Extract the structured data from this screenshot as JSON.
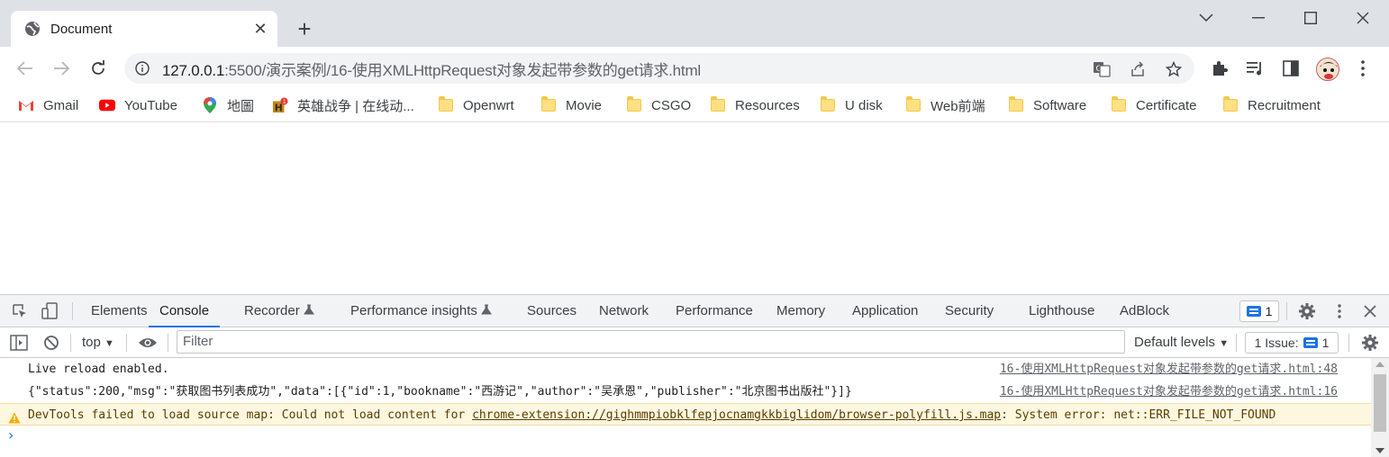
{
  "browser": {
    "tab": {
      "title": "Document"
    },
    "omnibox": {
      "host": "127.0.0.1",
      "path": ":5500/演示案例/16-使用XMLHttpRequest对象发起带参数的get请求.html"
    },
    "bookmarks": [
      {
        "label": "Gmail",
        "icon": "gmail-icon"
      },
      {
        "label": "YouTube",
        "icon": "youtube-icon"
      },
      {
        "label": "地圖",
        "icon": "maps-icon"
      },
      {
        "label": "英雄战争 | 在线动...",
        "icon": "game-icon"
      },
      {
        "label": "Openwrt",
        "icon": "folder-icon"
      },
      {
        "label": "Movie",
        "icon": "folder-icon"
      },
      {
        "label": "CSGO",
        "icon": "folder-icon"
      },
      {
        "label": "Resources",
        "icon": "folder-icon"
      },
      {
        "label": "U disk",
        "icon": "folder-icon"
      },
      {
        "label": "Web前端",
        "icon": "folder-icon"
      },
      {
        "label": "Software",
        "icon": "folder-icon"
      },
      {
        "label": "Certificate",
        "icon": "folder-icon"
      },
      {
        "label": "Recruitment",
        "icon": "folder-icon"
      }
    ]
  },
  "devtools": {
    "tabs": [
      "Elements",
      "Console",
      "Recorder",
      "Performance insights",
      "Sources",
      "Network",
      "Performance",
      "Memory",
      "Application",
      "Security",
      "Lighthouse",
      "AdBlock"
    ],
    "active_tab": "Console",
    "issue_count": "1",
    "toolbar": {
      "context": "top",
      "filter_placeholder": "Filter",
      "levels": "Default levels",
      "issues_label": "1 Issue:",
      "issues_count": "1"
    },
    "console": [
      {
        "type": "log",
        "message": "Live reload enabled.",
        "source": "16-使用XMLHttpRequest对象发起带参数的get请求.html:48"
      },
      {
        "type": "log",
        "message": "{\"status\":200,\"msg\":\"获取图书列表成功\",\"data\":[{\"id\":1,\"bookname\":\"西游记\",\"author\":\"吴承恩\",\"publisher\":\"北京图书出版社\"}]}",
        "source": "16-使用XMLHttpRequest对象发起带参数的get请求.html:16"
      },
      {
        "type": "warning",
        "prefix": "DevTools failed to load source map: Could not load content for ",
        "link": "chrome-extension://gighmmpiobklfepjocnamgkkbiglidom/browser-polyfill.js.map",
        "suffix": ": System error: net::ERR_FILE_NOT_FOUND"
      }
    ],
    "prompt": "›"
  }
}
